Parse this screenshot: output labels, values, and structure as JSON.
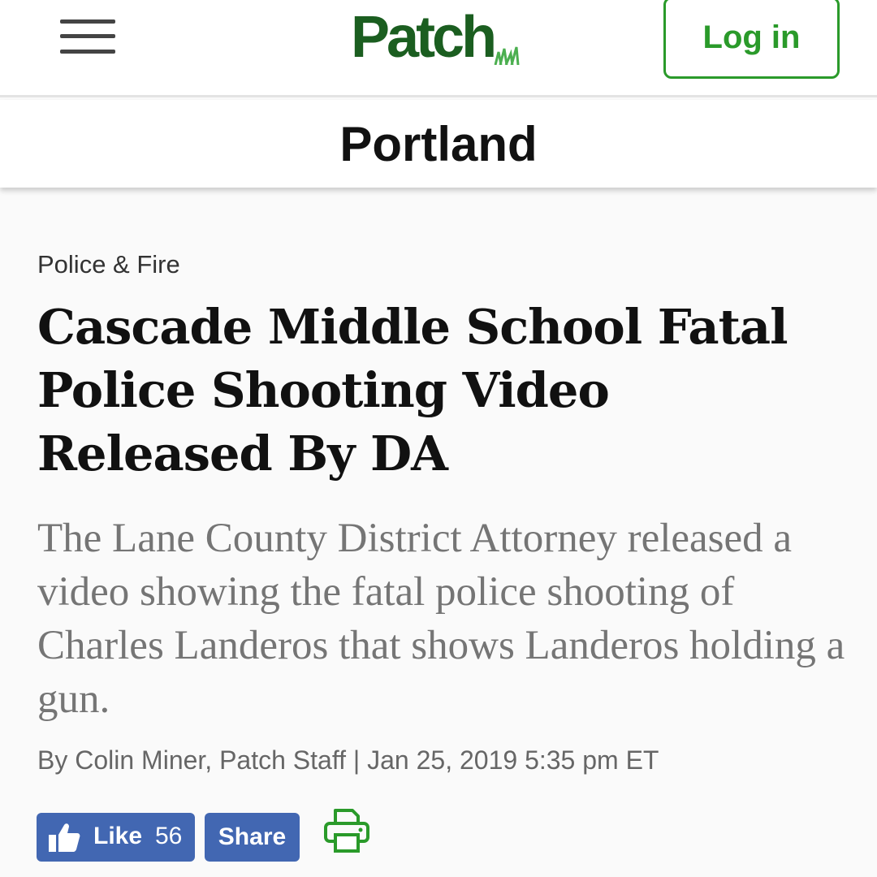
{
  "header": {
    "brand": "Patch",
    "login_label": "Log in",
    "city": "Portland"
  },
  "article": {
    "category": "Police & Fire",
    "headline": "Cascade Middle School Fatal Police Shooting Video Released By DA",
    "summary": "The Lane County District Attorney released a video showing the fatal police shooting of Charles Landeros that shows Landeros holding a gun.",
    "byline": "By Colin Miner, Patch Staff | Jan 25, 2019 5:35 pm ET"
  },
  "social": {
    "like_label": "Like",
    "like_count": "56",
    "share_label": "Share"
  },
  "icons": {
    "menu": "hamburger-menu-icon",
    "like": "thumbs-up-icon",
    "print": "printer-icon",
    "logo_grass": "grass-icon"
  },
  "colors": {
    "brand_green": "#1b5e20",
    "login_green": "#2a9a2a",
    "facebook_blue": "#4267b2",
    "summary_gray": "#757575"
  }
}
